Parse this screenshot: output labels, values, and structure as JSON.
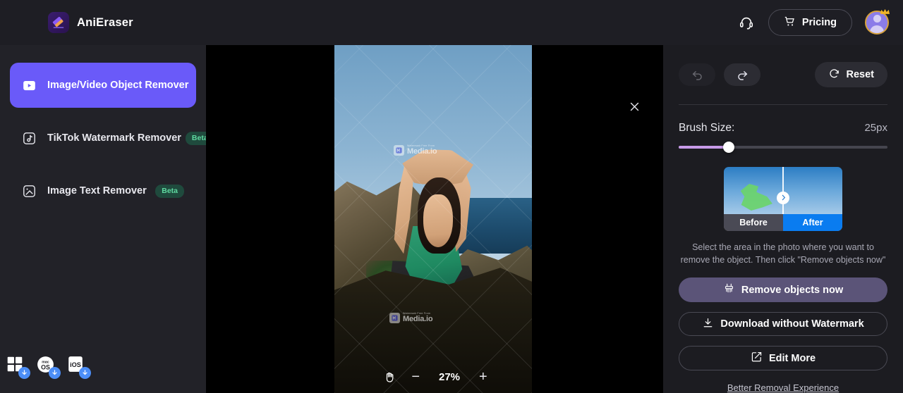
{
  "header": {
    "brand_name": "AniEraser",
    "logo_icon": "eraser-icon",
    "support_icon": "headset-icon",
    "pricing_label": "Pricing",
    "cart_icon": "cart-icon",
    "avatar_icon": "user-avatar",
    "crown_icon": "crown-icon",
    "accent_color": "#6a5af9"
  },
  "sidebar": {
    "items": [
      {
        "label": "Image/Video Object Remover",
        "icon": "play-square-icon",
        "active": true,
        "badge": ""
      },
      {
        "label": "TikTok Watermark Remover",
        "icon": "music-note-square-icon",
        "active": false,
        "badge": "Beta"
      },
      {
        "label": "Image Text Remover",
        "icon": "text-square-icon",
        "active": false,
        "badge": "Beta"
      }
    ],
    "platforms": [
      {
        "name": "windows-download",
        "label": "Windows",
        "icon": "windows-icon"
      },
      {
        "name": "macos-download",
        "label": "macOS",
        "icon": "macos-icon"
      },
      {
        "name": "ios-download",
        "label": "iOS",
        "icon": "ios-icon"
      }
    ]
  },
  "canvas": {
    "close_icon": "close-icon",
    "watermark_small": "Watermark Free From",
    "watermark_brand": "Media.io",
    "zoom": {
      "pan_icon": "hand-pan-icon",
      "zoom_out_label": "−",
      "value": "27%",
      "zoom_in_label": "+"
    }
  },
  "panel": {
    "undo_icon": "undo-icon",
    "redo_icon": "redo-icon",
    "reset_label": "Reset",
    "reset_icon": "refresh-icon",
    "brush_label": "Brush Size:",
    "brush_value": "25px",
    "brush_percent": 24,
    "demo": {
      "before_label": "Before",
      "after_label": "After",
      "chevron_icon": "chevron-right-icon",
      "after_bg": "#0a7cf0"
    },
    "hint": "Select the area in the photo where you want to remove the object. Then click \"Remove objects now\"",
    "remove_label": "Remove objects now",
    "remove_icon": "brush-icon",
    "download_label": "Download without Watermark",
    "download_icon": "download-icon",
    "edit_label": "Edit More",
    "edit_icon": "edit-square-icon",
    "better_link": "Better Removal Experience"
  }
}
